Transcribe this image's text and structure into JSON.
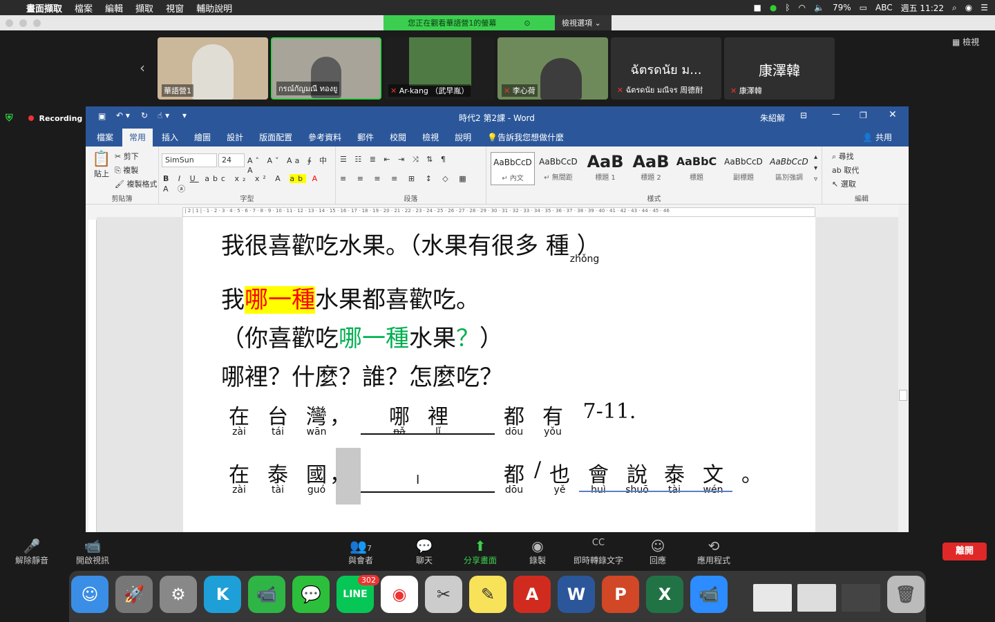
{
  "menubar": {
    "items": [
      "畫面擷取",
      "檔案",
      "編輯",
      "擷取",
      "視窗",
      "輔助說明"
    ],
    "battery": "79%",
    "input": "ABC",
    "clock": "週五 11:22"
  },
  "banner": {
    "viewing": "您正在觀看華語營1的螢幕",
    "options": "檢視選項 ⌄"
  },
  "view_button": "檢視",
  "recording": "Recording",
  "participants": [
    {
      "name": "華語營1",
      "big": ""
    },
    {
      "name": "กรณ์กัญมณี ทองยู",
      "big": ""
    },
    {
      "name": "Ar-kang （武早胤）",
      "big": ""
    },
    {
      "name": "李心荷",
      "big": ""
    },
    {
      "name": "ฉัตรดนัย มณีจร 周德耐",
      "big": "ฉัตรดนัย ม..."
    },
    {
      "name": "康澤韓",
      "big": "康澤韓"
    }
  ],
  "word": {
    "title": "時代2 第2課 - Word",
    "user": "朱紹解",
    "share": "共用",
    "tabs": [
      "檔案",
      "常用",
      "插入",
      "繪圖",
      "設計",
      "版面配置",
      "參考資料",
      "郵件",
      "校閱",
      "檢視",
      "說明",
      "告訴我您想做什麼"
    ],
    "clipboard": {
      "paste": "貼上",
      "cut": "剪下",
      "copy": "複製",
      "format": "複製格式",
      "label": "剪貼簿"
    },
    "font": {
      "name": "SimSun",
      "size": "24",
      "label": "字型"
    },
    "paragraph_label": "段落",
    "styles": [
      {
        "sample": "AaBbCcD",
        "name": "↵ 內文"
      },
      {
        "sample": "AaBbCcD",
        "name": "↵ 無間距"
      },
      {
        "sample": "AaB",
        "name": "標題 1"
      },
      {
        "sample": "AaB",
        "name": "標題 2"
      },
      {
        "sample": "AaBbC",
        "name": "標題"
      },
      {
        "sample": "AaBbCcD",
        "name": "副標題"
      },
      {
        "sample": "AaBbCcD",
        "name": "區別強調"
      }
    ],
    "styles_label": "樣式",
    "edit": {
      "find": "尋找",
      "replace": "取代",
      "select": "選取",
      "label": "編輯"
    }
  },
  "doc": {
    "l1": "我很喜歡吃水果。（水果有很多 種 ）",
    "l1_py": "zhǒng",
    "l2a": "我",
    "l2b": "哪一種",
    "l2c": "水果都喜歡吃。",
    "l3a": "（你喜歡吃",
    "l3b": "哪一種",
    "l3c": "水果",
    "l3d": "？",
    "l3e": "）",
    "l4": "哪裡？什麼？誰？怎麼吃？",
    "row1": [
      {
        "h": "在",
        "p": "zài"
      },
      {
        "h": "台",
        "p": "tái"
      },
      {
        "h": "灣",
        "p": "wān"
      },
      {
        "h": "，",
        "p": ""
      },
      {
        "h": "哪",
        "p": "nǎ"
      },
      {
        "h": "裡",
        "p": "lǐ"
      },
      {
        "h": "都",
        "p": "dōu"
      },
      {
        "h": "有",
        "p": "yǒu"
      }
    ],
    "row1_end": "7-11.",
    "row2": [
      {
        "h": "在",
        "p": "zài"
      },
      {
        "h": "泰",
        "p": "tài"
      },
      {
        "h": "國",
        "p": "guó"
      },
      {
        "h": "，",
        "p": ""
      },
      {
        "h": "都",
        "p": "dōu"
      },
      {
        "h": "/",
        "p": ""
      },
      {
        "h": "也",
        "p": "yě"
      },
      {
        "h": "會",
        "p": "huì"
      },
      {
        "h": "說",
        "p": "shuō"
      },
      {
        "h": "泰",
        "p": "tài"
      },
      {
        "h": "文",
        "p": "wén"
      },
      {
        "h": "。",
        "p": ""
      }
    ]
  },
  "controls": [
    {
      "icon": "mic-muted",
      "label": "解除靜音"
    },
    {
      "icon": "video-off",
      "label": "開啟視訊"
    },
    {
      "icon": "participants",
      "label": "與會者",
      "count": "7"
    },
    {
      "icon": "chat",
      "label": "聊天"
    },
    {
      "icon": "share",
      "label": "分享畫面"
    },
    {
      "icon": "record",
      "label": "錄製"
    },
    {
      "icon": "cc",
      "label": "即時轉錄文字"
    },
    {
      "icon": "reaction",
      "label": "回應"
    },
    {
      "icon": "apps",
      "label": "應用程式"
    }
  ],
  "leave": "離開",
  "dock_badge": "302",
  "colors": {
    "word_blue": "#2b579a",
    "share_green": "#3ccf4f",
    "leave_red": "#e02828",
    "highlight": "#ffff00",
    "green_text": "#00b050",
    "red_text": "#ff0000"
  }
}
